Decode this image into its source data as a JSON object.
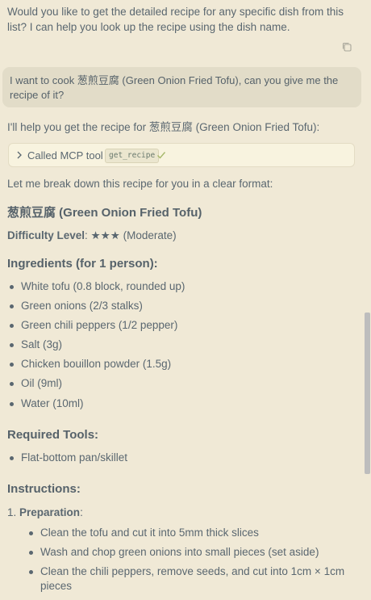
{
  "assistant_intro": "Would you like to get the detailed recipe for any specific dish from this list? I can help you look up the recipe using the dish name.",
  "user_message": "I want to cook 葱煎豆腐 (Green Onion Fried Tofu), can you give me the recipe of it?",
  "assistant_reply": "I'll help you get the recipe for 葱煎豆腐 (Green Onion Fried Tofu):",
  "tool_call": {
    "label": "Called MCP tool",
    "tool_name": "get_recipe"
  },
  "breakdown_intro": "Let me break down this recipe for you in a clear format:",
  "recipe": {
    "title": "葱煎豆腐 (Green Onion Fried Tofu)",
    "difficulty_label": "Difficulty Level",
    "difficulty_value": ": ★★★ (Moderate)",
    "ingredients_heading": "Ingredients (for 1 person):",
    "ingredients": [
      "White tofu (0.8 block, rounded up)",
      "Green onions (2/3 stalks)",
      "Green chili peppers (1/2 pepper)",
      "Salt (3g)",
      "Chicken bouillon powder (1.5g)",
      "Oil (9ml)",
      "Water (10ml)"
    ],
    "tools_heading": "Required Tools:",
    "tools": [
      "Flat-bottom pan/skillet"
    ],
    "instructions_heading": "Instructions:",
    "step1_number": "1.",
    "step1_label": "Preparation",
    "step1_colon": ":",
    "step1_items": [
      "Clean the tofu and cut it into 5mm thick slices",
      "Wash and chop green onions into small pieces (set aside)",
      "Clean the chili peppers, remove seeds, and cut into 1cm × 1cm pieces"
    ]
  },
  "colors": {
    "background": "#f0e9d6",
    "user_bubble": "#e2dcc8",
    "text": "#5a6770",
    "check": "#a6b86b"
  }
}
